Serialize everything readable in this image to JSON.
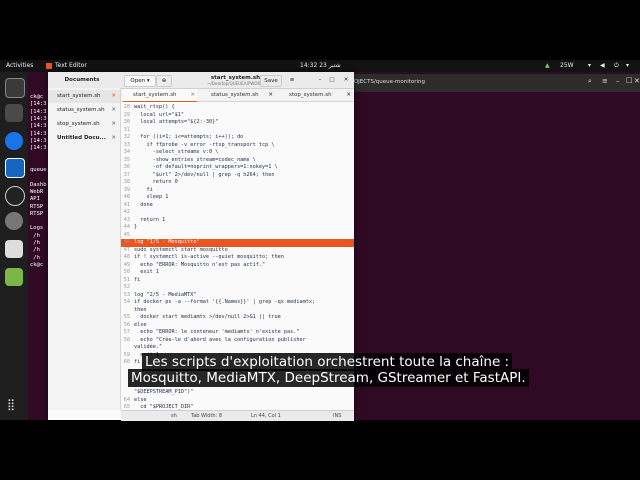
{
  "topbar": {
    "activities": "Activities",
    "app_name": "Text Editor",
    "clock": "14:32 شتبر 23",
    "network": "25W"
  },
  "terminal": {
    "title": "ROJECTS/queue-monitoring",
    "lines": [
      "ck@c",
      "[14:3",
      "[14:3",
      "[14:3",
      "[14:3",
      "[14:3",
      "[14:3",
      "[14:3",
      "",
      "",
      "queue",
      "",
      "Dashb",
      "WebR",
      "API",
      "RTSP",
      "RTSP",
      "",
      "Logs",
      " /h",
      " /h",
      " /h",
      " /h",
      "ck@c"
    ]
  },
  "gedit": {
    "documents_label": "Documents",
    "open_label": "Open",
    "title": "start_system.sh",
    "subtitle": "~/Desktop/QUEUE/UPWOR...",
    "save_label": "Save",
    "sidebar_items": [
      "start_system.sh",
      "status_system.sh",
      "stop_system.sh",
      "Untitled Docu..."
    ],
    "tabs": [
      "start_system.sh",
      "status_system.sh",
      "stop_system.sh"
    ],
    "status": {
      "lang": "sh",
      "tab_width": "Tab Width: 8",
      "position": "Ln 44, Col 1",
      "mode": "INS"
    }
  },
  "code_lines": [
    {
      "n": "28",
      "t": "wait_rtsp() {"
    },
    {
      "n": "29",
      "t": "  local url=\"$1\""
    },
    {
      "n": "30",
      "t": "  local attempts=\"${2:-30}\""
    },
    {
      "n": "31",
      "t": ""
    },
    {
      "n": "32",
      "t": "  for ((i=1; i<=attempts; i++)); do"
    },
    {
      "n": "33",
      "t": "    if ffprobe -v error -rtsp_transport tcp \\"
    },
    {
      "n": "34",
      "t": "      -select_streams v:0 \\"
    },
    {
      "n": "35",
      "t": "      -show_entries stream=codec_name \\"
    },
    {
      "n": "36",
      "t": "      -of default=noprint_wrappers=1:nokey=1 \\"
    },
    {
      "n": "37",
      "t": "      \"$url\" 2>/dev/null | grep -q h264; then"
    },
    {
      "n": "38",
      "t": "      return 0"
    },
    {
      "n": "39",
      "t": "    fi"
    },
    {
      "n": "40",
      "t": "    sleep 1"
    },
    {
      "n": "41",
      "t": "  done"
    },
    {
      "n": "42",
      "t": ""
    },
    {
      "n": "43",
      "t": "  return 1"
    },
    {
      "n": "44",
      "t": "}"
    },
    {
      "n": "45",
      "t": ""
    },
    {
      "n": "46",
      "t": "log \"1/5 - Mosquitto\""
    },
    {
      "n": "47",
      "t": "sudo systemctl start mosquitto"
    },
    {
      "n": "48",
      "t": "if ! systemctl is-active --quiet mosquitto; then"
    },
    {
      "n": "49",
      "t": "  echo \"ERROR: Mosquitto n'est pas actif.\""
    },
    {
      "n": "50",
      "t": "  exit 1"
    },
    {
      "n": "51",
      "t": "fi"
    },
    {
      "n": "52",
      "t": ""
    },
    {
      "n": "53",
      "t": "log \"2/5 - MediaMTX\""
    },
    {
      "n": "54",
      "t": "if docker ps -a --format '{{.Names}}' | grep -qx mediamtx;"
    },
    {
      "n": "",
      "t": "then"
    },
    {
      "n": "55",
      "t": "  docker start mediamtx >/dev/null 2>&1 || true"
    },
    {
      "n": "56",
      "t": "else"
    },
    {
      "n": "57",
      "t": "  echo \"ERROR: le conteneur 'mediamtx' n'existe pas.\""
    },
    {
      "n": "58",
      "t": "  echo \"Crée-le d'abord avec la configuration publisher"
    },
    {
      "n": "",
      "t": "validée.\""
    },
    {
      "n": "59",
      "t": "  exit 1"
    },
    {
      "n": "60",
      "t": "fi"
    },
    {
      "n": "",
      "t": ""
    },
    {
      "n": "",
      "t": ""
    },
    {
      "n": "",
      "t": ""
    },
    {
      "n": "",
      "t": "\"$DEEPSTREAM_PID\")\""
    },
    {
      "n": "64",
      "t": "else"
    },
    {
      "n": "65",
      "t": "  cd \"$PROJECT_DIR\""
    }
  ],
  "subtitles": {
    "line1": "Les scripts d'exploitation orchestrent toute la chaîne :",
    "line2": "Mosquitto, MediaMTX, DeepStream, GStreamer et FastAPI."
  },
  "colors": {
    "terminal_bg": "#300a24",
    "highlight_line": "#e95420",
    "accent_orange": "#e05e1e"
  }
}
